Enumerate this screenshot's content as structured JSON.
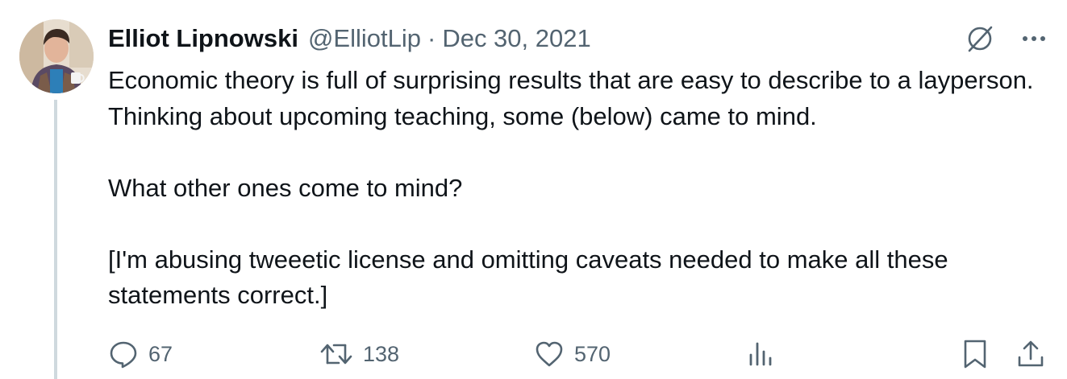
{
  "tweet": {
    "author": {
      "display_name": "Elliot Lipnowski",
      "handle": "@ElliotLip"
    },
    "separator": "·",
    "date": "Dec 30, 2021",
    "body": {
      "paragraph1": "Economic theory is full of surprising results that are easy to describe to a layperson. Thinking about upcoming teaching, some (below) came to mind.",
      "paragraph2": "What other ones come to mind?",
      "paragraph3": "[I'm abusing tweeetic license and omitting caveats needed to make all these statements correct.]"
    },
    "stats": {
      "replies": "67",
      "retweets": "138",
      "likes": "570"
    },
    "icons": {
      "grok": "grok-icon",
      "more": "more-icon",
      "reply": "reply-icon",
      "retweet": "retweet-icon",
      "like": "like-icon",
      "views": "views-icon",
      "bookmark": "bookmark-icon",
      "share": "share-icon"
    },
    "colors": {
      "text": "#0f1419",
      "secondary": "#536471",
      "thread_line": "#cfd9de"
    }
  }
}
